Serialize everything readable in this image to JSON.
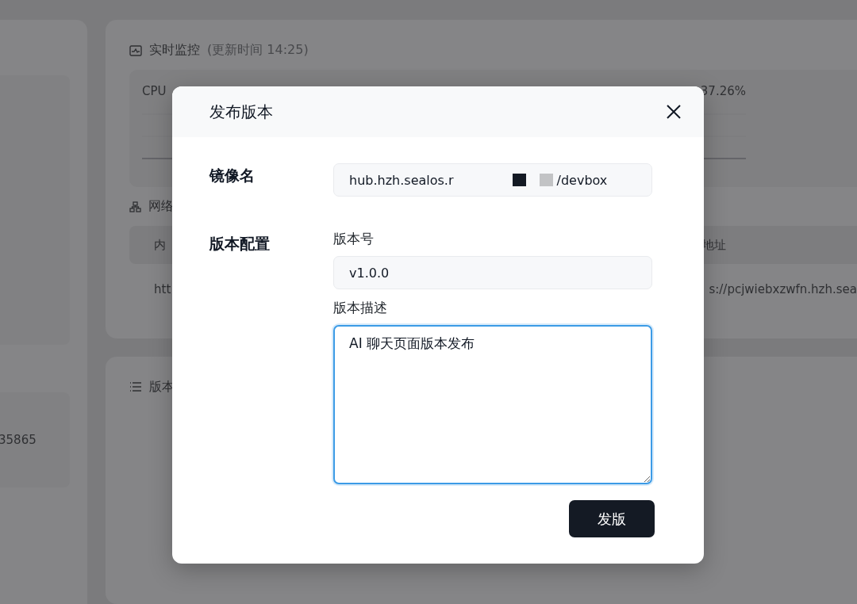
{
  "background": {
    "left_panel": {
      "value": "35865"
    },
    "monitor": {
      "title": "实时监控",
      "updated": "(更新时间 14:25)",
      "cpu_label": "CPU",
      "reading": "37.26%"
    },
    "network": {
      "title": "网络",
      "columns": [
        "内",
        "地址"
      ],
      "row": [
        "htt",
        "s://pcjwiebxzwfn.hzh.sea"
      ]
    },
    "versions": {
      "title": "版本"
    }
  },
  "dialog": {
    "title": "发布版本",
    "image": {
      "label": "镜像名",
      "value_start": "hub.hzh.sealos.r",
      "value_end": "/devbox"
    },
    "config": {
      "label": "版本配置",
      "fields": [
        {
          "kind": "input",
          "label": "版本号",
          "value": "v1.0.0",
          "focused": false
        },
        {
          "kind": "textarea",
          "label": "版本描述",
          "value": "AI 聊天页面版本发布",
          "focused": true
        }
      ]
    },
    "submit": "发版"
  }
}
